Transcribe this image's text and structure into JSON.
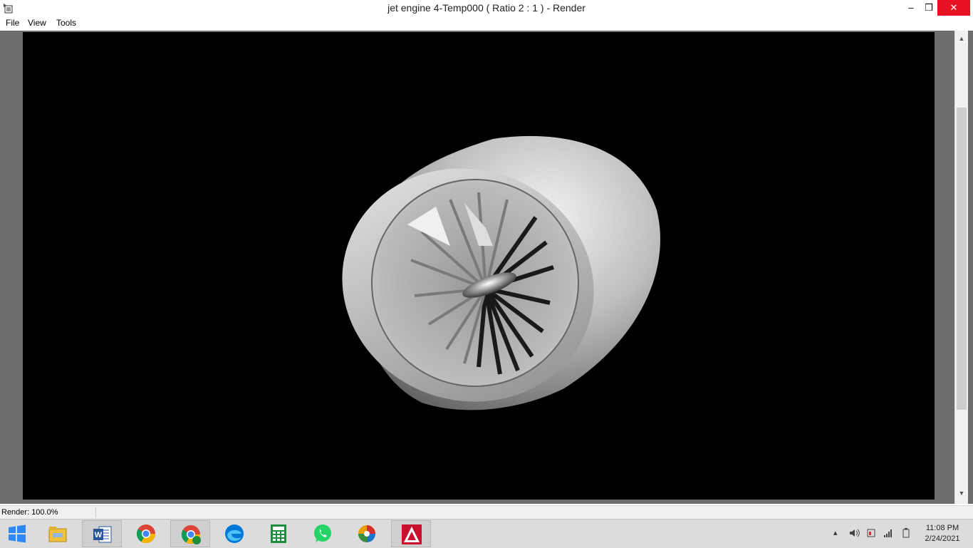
{
  "window": {
    "title": "jet engine 4-Temp000  ( Ratio 2 : 1 ) - Render",
    "controls": {
      "minimize": "–",
      "maximize": "❒",
      "close": "✕"
    }
  },
  "menu": {
    "items": [
      "File",
      "View",
      "Tools"
    ]
  },
  "render": {
    "subject": "jet-engine-render"
  },
  "scrollbar": {
    "up": "▲",
    "down": "▼"
  },
  "status": {
    "text": "Render: 100.0%"
  },
  "taskbar": {
    "apps": [
      {
        "name": "file-explorer-icon",
        "color": "#f0c040",
        "active": false
      },
      {
        "name": "word-icon",
        "color": "#2b579a",
        "active": true
      },
      {
        "name": "chrome-icon",
        "color": "#db4437",
        "active": false
      },
      {
        "name": "chrome-profile-icon",
        "color": "#0f9d58",
        "active": true
      },
      {
        "name": "edge-icon",
        "color": "#0078d7",
        "active": false
      },
      {
        "name": "calculator-icon",
        "color": "#1e8e3e",
        "active": false
      },
      {
        "name": "whatsapp-icon",
        "color": "#25d366",
        "active": false
      },
      {
        "name": "color-app-icon",
        "color": "#e8a000",
        "active": false
      },
      {
        "name": "autocad-icon",
        "color": "#c8102e",
        "active": true
      }
    ],
    "tray": {
      "chevron": "▴"
    },
    "clock": {
      "time": "11:08 PM",
      "date": "2/24/2021"
    }
  }
}
